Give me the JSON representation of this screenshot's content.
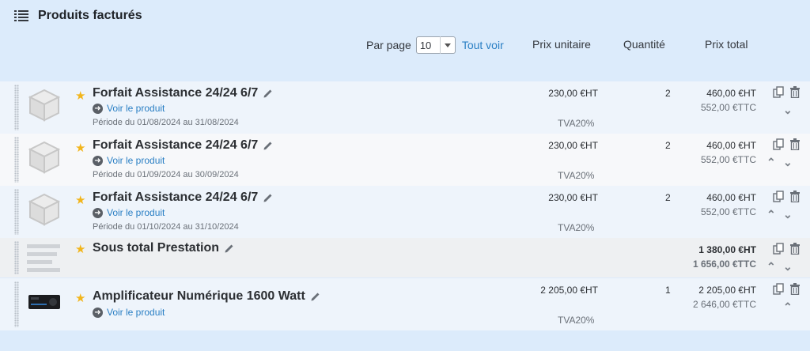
{
  "header": {
    "title": "Produits facturés",
    "icon": "list-icon"
  },
  "toolbar": {
    "per_page_label": "Par page",
    "per_page_value": "10",
    "show_all": "Tout voir"
  },
  "columns": {
    "unit_price": "Prix unitaire",
    "quantity": "Quantité",
    "total_price": "Prix total"
  },
  "rows": [
    {
      "title": "Forfait Assistance 24/24 6/7",
      "link": "Voir le produit",
      "period": "Période du 01/08/2024 au 31/08/2024",
      "unit_price": "230,00 €HT",
      "tva": "TVA20%",
      "qty": "2",
      "total_ht": "460,00 €HT",
      "total_ttc": "552,00 €TTC"
    },
    {
      "title": "Forfait Assistance 24/24 6/7",
      "link": "Voir le produit",
      "period": "Période du 01/09/2024 au 30/09/2024",
      "unit_price": "230,00 €HT",
      "tva": "TVA20%",
      "qty": "2",
      "total_ht": "460,00 €HT",
      "total_ttc": "552,00 €TTC"
    },
    {
      "title": "Forfait Assistance 24/24 6/7",
      "link": "Voir le produit",
      "period": "Période du 01/10/2024 au 31/10/2024",
      "unit_price": "230,00 €HT",
      "tva": "TVA20%",
      "qty": "2",
      "total_ht": "460,00 €HT",
      "total_ttc": "552,00 €TTC"
    },
    {
      "title": "Sous total Prestation",
      "total_ht": "1 380,00 €HT",
      "total_ttc": "1 656,00 €TTC"
    },
    {
      "title": "Amplificateur Numérique 1600 Watt",
      "link": "Voir le produit",
      "unit_price": "2 205,00 €HT",
      "tva": "TVA20%",
      "qty": "1",
      "total_ht": "2 205,00 €HT",
      "total_ttc": "2 646,00 €TTC"
    }
  ],
  "colors": {
    "accent": "#2a7fc4",
    "star": "#f2b51b",
    "header_bg": "#dcebfb"
  }
}
